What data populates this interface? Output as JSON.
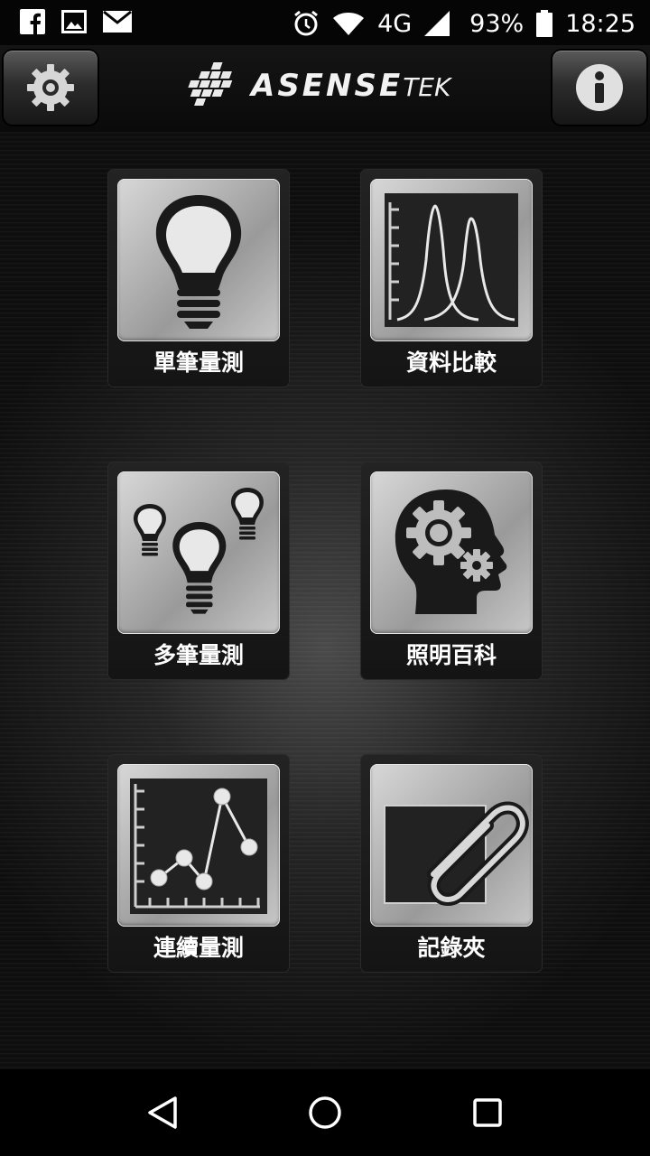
{
  "status_bar": {
    "icons_left": [
      "facebook-icon",
      "image-icon",
      "mail-icon"
    ],
    "icons_right": [
      "alarm-icon",
      "wifi-icon",
      "signal-icon",
      "battery-icon"
    ],
    "network": "4G",
    "battery": "93%",
    "time": "18:25"
  },
  "header": {
    "logo_main": "ASENSE",
    "logo_suffix": "TEK",
    "settings_icon": "gear-icon",
    "info_icon": "info-icon"
  },
  "menu": {
    "single_measure": "單筆量測",
    "data_compare": "資料比較",
    "multi_measure": "多筆量測",
    "lighting_wiki": "照明百科",
    "continuous_measure": "連續量測",
    "records_folder": "記錄夾"
  },
  "nav": {
    "back_icon": "back-triangle-icon",
    "home_icon": "home-circle-icon",
    "recents_icon": "recents-square-icon"
  },
  "colors": {
    "background": "#000000",
    "tile_metal": "#b4b4b4",
    "icon_dark": "#1a1a1a",
    "label": "#ffffff"
  }
}
